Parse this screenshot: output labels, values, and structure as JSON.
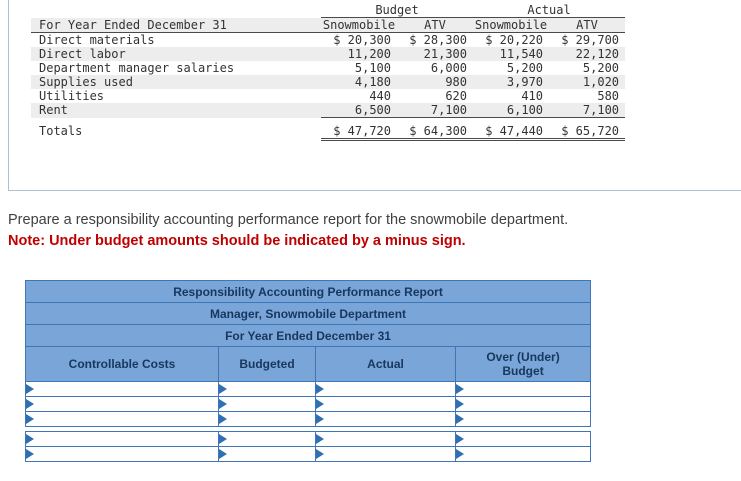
{
  "colors": {
    "panel_border": "#adc1d6",
    "stripe": "#ededed",
    "src_text": "#333333",
    "rule": "#4a4a4a",
    "instruction_text": "#404040",
    "note_red": "#c00000",
    "report_header_bg": "#7aa5d8",
    "report_border": "#3f76b6",
    "report_text": "#17375e",
    "marker_blue": "#2f6fb4"
  },
  "source_table": {
    "group_headers": [
      "Budget",
      "Actual"
    ],
    "row_header": "For Year Ended December 31",
    "col_headers": [
      "Snowmobile",
      "ATV",
      "Snowmobile",
      "ATV"
    ],
    "rows": [
      {
        "label": "Direct materials",
        "values": [
          "$ 20,300",
          "$ 28,300",
          "$ 20,220",
          "$ 29,700"
        ]
      },
      {
        "label": "Direct labor",
        "values": [
          "11,200",
          "21,300",
          "11,540",
          "22,120"
        ]
      },
      {
        "label": "Department manager salaries",
        "values": [
          "5,100",
          "6,000",
          "5,200",
          "5,200"
        ]
      },
      {
        "label": "Supplies used",
        "values": [
          "4,180",
          "980",
          "3,970",
          "1,020"
        ]
      },
      {
        "label": "Utilities",
        "values": [
          "440",
          "620",
          "410",
          "580"
        ]
      },
      {
        "label": "Rent",
        "values": [
          "6,500",
          "7,100",
          "6,100",
          "7,100"
        ]
      }
    ],
    "totals": {
      "label": "Totals",
      "values": [
        "$ 47,720",
        "$ 64,300",
        "$ 47,440",
        "$ 65,720"
      ]
    }
  },
  "instructions": {
    "prompt": "Prepare a responsibility accounting performance report for the snowmobile department.",
    "note": "Note: Under budget amounts should be indicated by a minus sign."
  },
  "report": {
    "title": "Responsibility Accounting Performance Report",
    "subtitle": "Manager, Snowmobile Department",
    "period": "For Year Ended December 31",
    "columns": [
      "Controllable Costs",
      "Budgeted",
      "Actual",
      "Over (Under)\nBudget"
    ]
  }
}
